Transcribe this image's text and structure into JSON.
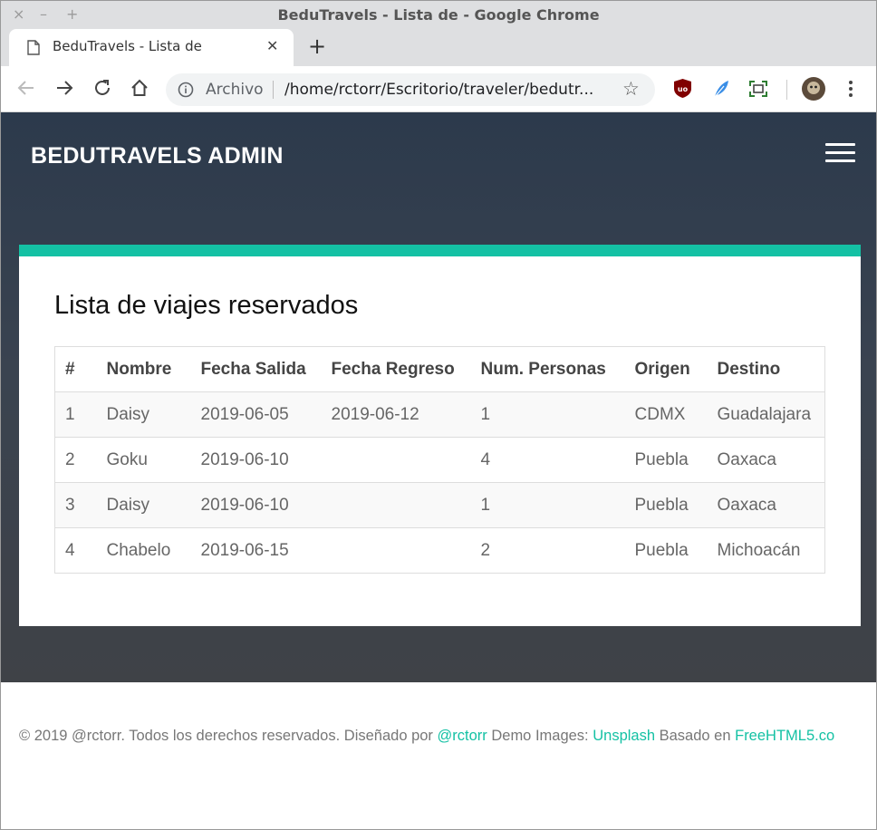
{
  "window": {
    "title": "BeduTravels - Lista de - Google Chrome",
    "close_glyph": "×",
    "min_glyph": "–",
    "max_glyph": "+"
  },
  "tab": {
    "title": "BeduTravels - Lista de",
    "close_glyph": "✕",
    "new_tab_glyph": "+"
  },
  "toolbar": {
    "security_label": "Archivo",
    "url": "/home/rctorr/Escritorio/traveler/bedutr...",
    "star_glyph": "☆"
  },
  "site": {
    "brand": "BEDUTRAVELS ADMIN",
    "accent_color": "#14c1a4"
  },
  "card": {
    "title": "Lista de viajes reservados",
    "columns": [
      "#",
      "Nombre",
      "Fecha Salida",
      "Fecha Regreso",
      "Num. Personas",
      "Origen",
      "Destino"
    ],
    "rows": [
      [
        "1",
        "Daisy",
        "2019-06-05",
        "2019-06-12",
        "1",
        "CDMX",
        "Guadalajara"
      ],
      [
        "2",
        "Goku",
        "2019-06-10",
        "",
        "4",
        "Puebla",
        "Oaxaca"
      ],
      [
        "3",
        "Daisy",
        "2019-06-10",
        "",
        "1",
        "Puebla",
        "Oaxaca"
      ],
      [
        "4",
        "Chabelo",
        "2019-06-15",
        "",
        "2",
        "Puebla",
        "Michoacán"
      ]
    ]
  },
  "footer": {
    "prefix": "© 2019 @rctorr. Todos los derechos reservados. Diseñado por ",
    "link1": "@rctorr",
    "mid": " Demo Images: ",
    "link2": "Unsplash",
    "mid2": " Basado en ",
    "link3": "FreeHTML5.co"
  }
}
